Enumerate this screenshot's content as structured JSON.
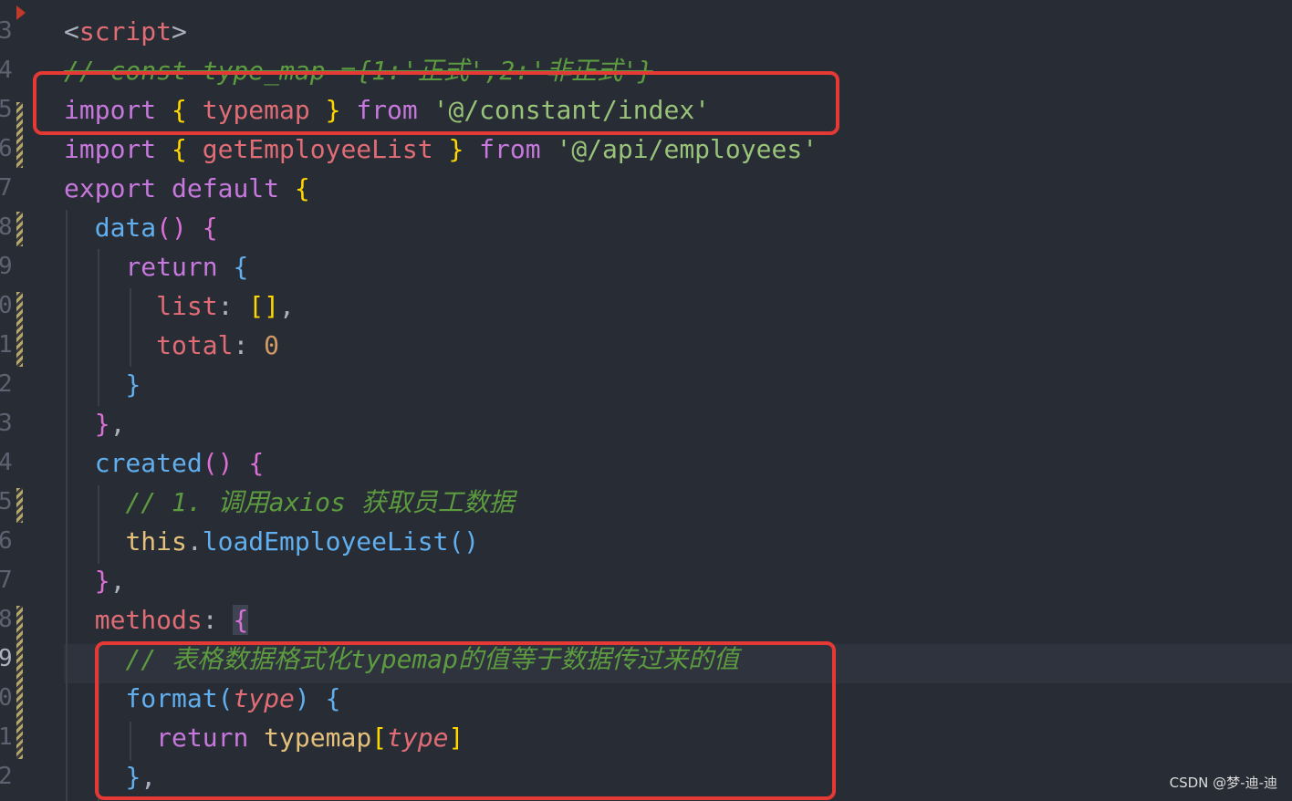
{
  "gutter": {
    "line_numbers": [
      "3",
      "4",
      "5",
      "6",
      "7",
      "8",
      "9",
      "0",
      "1",
      "2",
      "3",
      "4",
      "5",
      "6",
      "7",
      "8",
      "9",
      "0",
      "1",
      "2"
    ],
    "active_index": 16
  },
  "code": {
    "l0": {
      "a": "<",
      "b": "script",
      "c": ">"
    },
    "l1": {
      "comment": "// const type_map ={1:'正式',2:'非正式'}"
    },
    "l2": {
      "kw1": "import",
      "ob": "{",
      "id": " typemap ",
      "cb": "}",
      "kw2": "from",
      "str": "'@/constant/index'"
    },
    "l3": {
      "kw1": "import",
      "ob": "{",
      "id": " getEmployeeList ",
      "cb": "}",
      "kw2": "from",
      "str": "'@/api/employees'"
    },
    "l4": {
      "kw1": "export",
      "kw2": "default",
      "ob": "{"
    },
    "l5": {
      "fn": "data",
      "par": "()",
      "ob": "{"
    },
    "l6": {
      "kw": "return",
      "ob": "{"
    },
    "l7": {
      "prop": "list",
      "colon": ": ",
      "val": "[]",
      "comma": ","
    },
    "l8": {
      "prop": "total",
      "colon": ": ",
      "num": "0"
    },
    "l9": {
      "cb": "}"
    },
    "l10": {
      "cb": "}",
      "comma": ","
    },
    "l11": {
      "fn": "created",
      "par": "()",
      "ob": "{"
    },
    "l12": {
      "comment": "// 1. 调用axios 获取员工数据"
    },
    "l13": {
      "this": "this",
      "dot": ".",
      "fn": "loadEmployeeList",
      "par": "()"
    },
    "l14": {
      "cb": "}",
      "comma": ","
    },
    "l15": {
      "prop": "methods",
      "colon": ": ",
      "ob": "{"
    },
    "l16": {
      "comment": "// 表格数据格式化typemap的值等于数据传过来的值"
    },
    "l17": {
      "fn": "format",
      "op": "(",
      "param": "type",
      "cp": ")",
      "ob": "{"
    },
    "l18": {
      "kw": "return",
      "id": "typemap",
      "ob": "[",
      "param": "type",
      "cb": "]"
    },
    "l19": {
      "cb": "}",
      "comma": ","
    }
  },
  "colors": {
    "background": "#282c34",
    "highlight_box": "#e53935",
    "keyword": "#c678dd",
    "function": "#61afef",
    "string": "#98c379",
    "comment": "#5c9b3f"
  },
  "watermark": "CSDN @梦-迪-迪"
}
